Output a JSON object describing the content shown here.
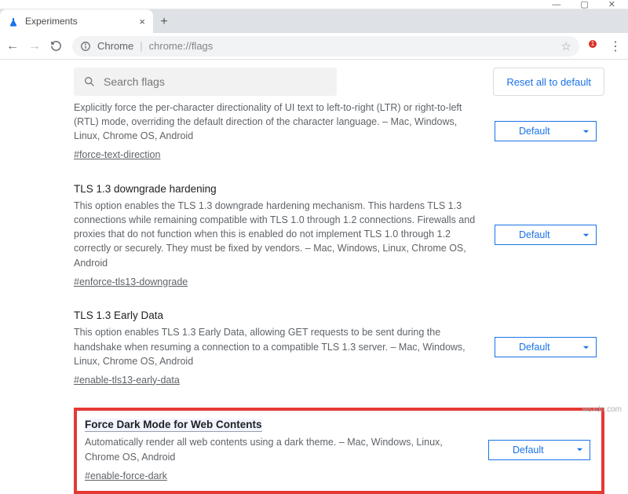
{
  "window": {
    "tab_title": "Experiments",
    "omnibox_label": "Chrome",
    "omnibox_url": "chrome://flags"
  },
  "search": {
    "placeholder": "Search flags",
    "reset_label": "Reset all to default"
  },
  "dropdown_default": "Default",
  "flags": {
    "force_text_direction": {
      "desc": "Explicitly force the per-character directionality of UI text to left-to-right (LTR) or right-to-left (RTL) mode, overriding the default direction of the character language. – Mac, Windows, Linux, Chrome OS, Android",
      "hash": "#force-text-direction"
    },
    "tls13_downgrade": {
      "title": "TLS 1.3 downgrade hardening",
      "desc": "This option enables the TLS 1.3 downgrade hardening mechanism. This hardens TLS 1.3 connections while remaining compatible with TLS 1.0 through 1.2 connections. Firewalls and proxies that do not function when this is enabled do not implement TLS 1.0 through 1.2 correctly or securely. They must be fixed by vendors. – Mac, Windows, Linux, Chrome OS, Android",
      "hash": "#enforce-tls13-downgrade"
    },
    "tls13_early": {
      "title": "TLS 1.3 Early Data",
      "desc": "This option enables TLS 1.3 Early Data, allowing GET requests to be sent during the handshake when resuming a connection to a compatible TLS 1.3 server. – Mac, Windows, Linux, Chrome OS, Android",
      "hash": "#enable-tls13-early-data"
    },
    "force_dark": {
      "title": "Force Dark Mode for Web Contents",
      "desc": "Automatically render all web contents using a dark theme. – Mac, Windows, Linux, Chrome OS, Android",
      "hash": "#enable-force-dark"
    }
  },
  "watermark": "wsxdn.com"
}
